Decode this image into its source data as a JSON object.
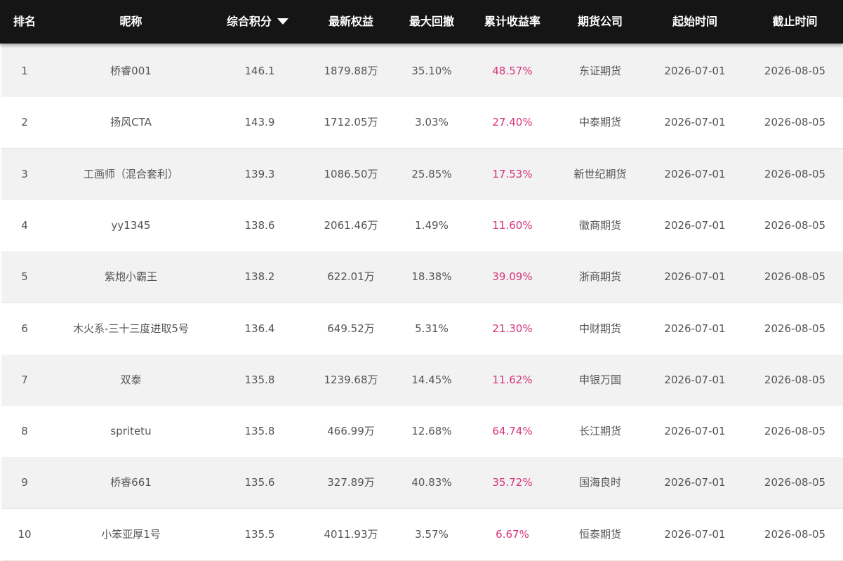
{
  "colors": {
    "header_bg": "#151515",
    "header_text": "#ffffff",
    "row_odd": "#f2f2f2",
    "row_even": "#ffffff",
    "cell_text": "#555555",
    "return_text": "#d6337a"
  },
  "header": {
    "rank": "排名",
    "nickname": "昵称",
    "score": "综合积分",
    "score_sort_icon": "caret-down-icon",
    "equity": "最新权益",
    "drawdown": "最大回撤",
    "return": "累计收益率",
    "company": "期货公司",
    "start": "起始时间",
    "end": "截止时间"
  },
  "rows": [
    {
      "rank": "1",
      "nickname": "桥睿001",
      "score": "146.1",
      "equity": "1879.88万",
      "drawdown": "35.10%",
      "return": "48.57%",
      "company": "东证期货",
      "start": "2026-07-01",
      "end": "2026-08-05"
    },
    {
      "rank": "2",
      "nickname": "扬风CTA",
      "score": "143.9",
      "equity": "1712.05万",
      "drawdown": "3.03%",
      "return": "27.40%",
      "company": "中泰期货",
      "start": "2026-07-01",
      "end": "2026-08-05"
    },
    {
      "rank": "3",
      "nickname": "工画师（混合套利）",
      "score": "139.3",
      "equity": "1086.50万",
      "drawdown": "25.85%",
      "return": "17.53%",
      "company": "新世纪期货",
      "start": "2026-07-01",
      "end": "2026-08-05"
    },
    {
      "rank": "4",
      "nickname": "yy1345",
      "score": "138.6",
      "equity": "2061.46万",
      "drawdown": "1.49%",
      "return": "11.60%",
      "company": "徽商期货",
      "start": "2026-07-01",
      "end": "2026-08-05"
    },
    {
      "rank": "5",
      "nickname": "紫炮小霸王",
      "score": "138.2",
      "equity": "622.01万",
      "drawdown": "18.38%",
      "return": "39.09%",
      "company": "浙商期货",
      "start": "2026-07-01",
      "end": "2026-08-05"
    },
    {
      "rank": "6",
      "nickname": "木火系-三十三度进取5号",
      "score": "136.4",
      "equity": "649.52万",
      "drawdown": "5.31%",
      "return": "21.30%",
      "company": "中财期货",
      "start": "2026-07-01",
      "end": "2026-08-05"
    },
    {
      "rank": "7",
      "nickname": "双泰",
      "score": "135.8",
      "equity": "1239.68万",
      "drawdown": "14.45%",
      "return": "11.62%",
      "company": "申银万国",
      "start": "2026-07-01",
      "end": "2026-08-05"
    },
    {
      "rank": "8",
      "nickname": "spritetu",
      "score": "135.8",
      "equity": "466.99万",
      "drawdown": "12.68%",
      "return": "64.74%",
      "company": "长江期货",
      "start": "2026-07-01",
      "end": "2026-08-05"
    },
    {
      "rank": "9",
      "nickname": "桥睿661",
      "score": "135.6",
      "equity": "327.89万",
      "drawdown": "40.83%",
      "return": "35.72%",
      "company": "国海良时",
      "start": "2026-07-01",
      "end": "2026-08-05"
    },
    {
      "rank": "10",
      "nickname": "小笨亚厚1号",
      "score": "135.5",
      "equity": "4011.93万",
      "drawdown": "3.57%",
      "return": "6.67%",
      "company": "恒泰期货",
      "start": "2026-07-01",
      "end": "2026-08-05"
    }
  ]
}
